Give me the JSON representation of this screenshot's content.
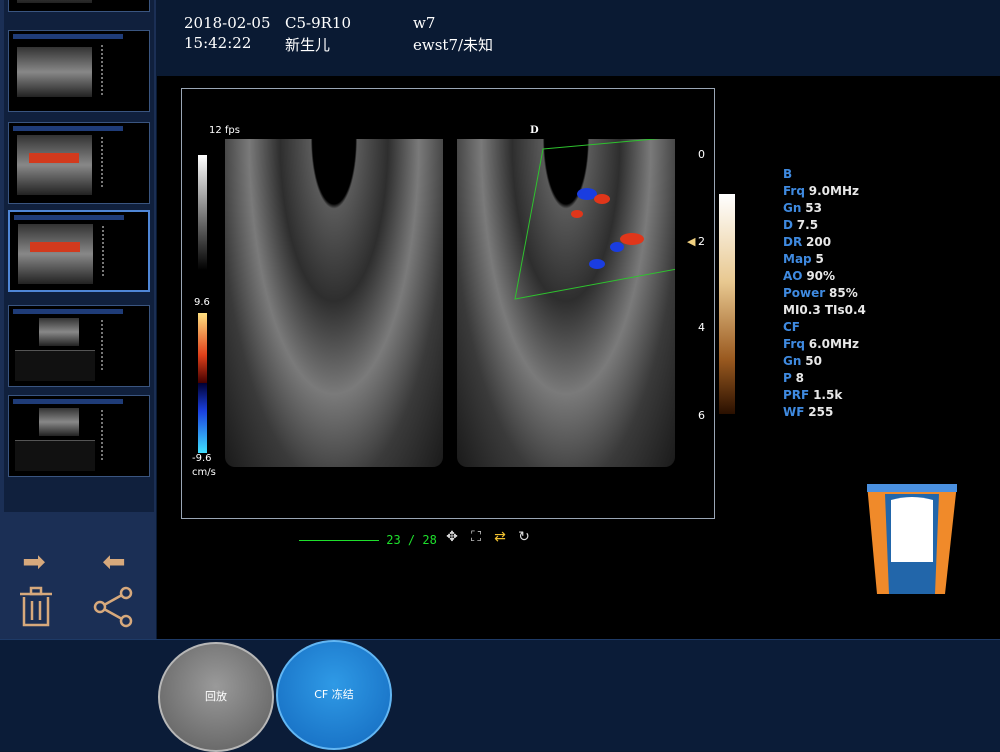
{
  "header": {
    "date": "2018-02-05",
    "probe": "C5-9R10",
    "preset": "w7",
    "time": "15:42:22",
    "patient_type": "新生儿",
    "user": "ewst7/未知"
  },
  "image": {
    "fps": "12 fps",
    "label": "D",
    "scale_top": "9.6",
    "scale_bottom": "-9.6",
    "scale_unit": "cm/s",
    "depth_marks": [
      "0",
      "2",
      "4",
      "6"
    ]
  },
  "params": {
    "b_title": "B",
    "b": [
      {
        "k": "Frq",
        "v": "9.0MHz"
      },
      {
        "k": "Gn",
        "v": "53"
      },
      {
        "k": "D",
        "v": "7.5"
      },
      {
        "k": "DR",
        "v": "200"
      },
      {
        "k": "Map",
        "v": "5"
      },
      {
        "k": "AO",
        "v": "90%"
      },
      {
        "k": "Power",
        "v": "85%"
      }
    ],
    "mi_ti": "MI0.3  TIs0.4",
    "cf_title": "CF",
    "cf": [
      {
        "k": "Frq",
        "v": "6.0MHz"
      },
      {
        "k": "Gn",
        "v": "50"
      },
      {
        "k": "P",
        "v": "8"
      },
      {
        "k": "PRF",
        "v": "1.5k"
      },
      {
        "k": "WF",
        "v": "255"
      }
    ]
  },
  "cine": {
    "frame": "23",
    "separator": "/",
    "total": "28"
  },
  "buttons": {
    "playback": "回放",
    "cf_freeze": "CF 冻结"
  },
  "colors": {
    "accent": "#3f8ae0",
    "cine": "#1ee02c",
    "arrow": "#d7a97c"
  }
}
